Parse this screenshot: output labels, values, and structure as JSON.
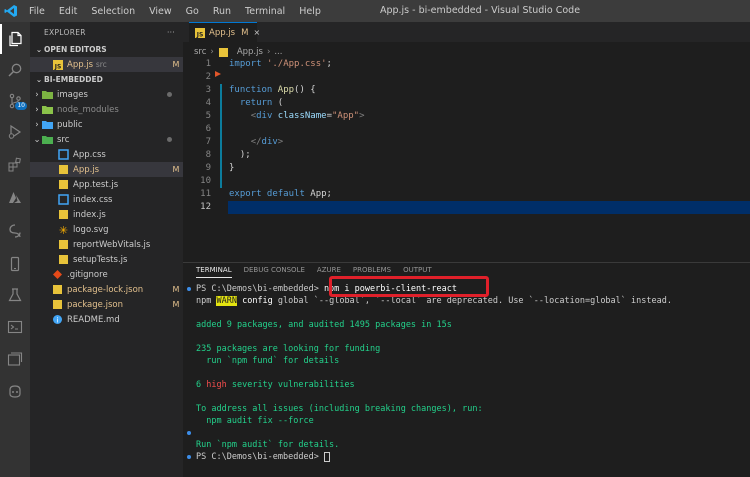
{
  "menu": [
    "File",
    "Edit",
    "Selection",
    "View",
    "Go",
    "Run",
    "Terminal",
    "Help"
  ],
  "window_title": "App.js - bi-embedded - Visual Studio Code",
  "activity_badge": "10",
  "sidebar": {
    "title": "EXPLORER",
    "more": "···",
    "open_editors": {
      "header": "OPEN EDITORS",
      "file": "App.js",
      "folder": "src",
      "status": "M"
    },
    "project": {
      "header": "BI-EMBEDDED",
      "items": [
        {
          "label": "images",
          "type": "folder",
          "status": "dot"
        },
        {
          "label": "node_modules",
          "type": "folder",
          "status": ""
        },
        {
          "label": "public",
          "type": "folder",
          "status": ""
        },
        {
          "label": "src",
          "type": "folder-open",
          "status": "dot"
        },
        {
          "label": "App.css",
          "type": "css",
          "status": ""
        },
        {
          "label": "App.js",
          "type": "js",
          "status": "M"
        },
        {
          "label": "App.test.js",
          "type": "test",
          "status": ""
        },
        {
          "label": "index.css",
          "type": "css",
          "status": ""
        },
        {
          "label": "index.js",
          "type": "js",
          "status": ""
        },
        {
          "label": "logo.svg",
          "type": "svg",
          "status": ""
        },
        {
          "label": "reportWebVitals.js",
          "type": "js",
          "status": ""
        },
        {
          "label": "setupTests.js",
          "type": "js",
          "status": ""
        },
        {
          "label": ".gitignore",
          "type": "git",
          "status": ""
        },
        {
          "label": "package-lock.json",
          "type": "json",
          "status": "M"
        },
        {
          "label": "package.json",
          "type": "json",
          "status": "M"
        },
        {
          "label": "README.md",
          "type": "md",
          "status": ""
        }
      ]
    }
  },
  "editor": {
    "tab_label": "App.js",
    "tab_status": "M",
    "breadcrumb": [
      "src",
      "App.js",
      "..."
    ],
    "lines": [
      {
        "n": "1",
        "tokens": [
          [
            "k",
            "import "
          ],
          [
            "s",
            "'./App.css'"
          ],
          [
            "",
            "; "
          ]
        ]
      },
      {
        "n": "2",
        "tokens": []
      },
      {
        "n": "3",
        "tokens": [
          [
            "k",
            "function "
          ],
          [
            "f",
            "App"
          ],
          [
            "",
            "() {"
          ]
        ]
      },
      {
        "n": "4",
        "tokens": [
          [
            "",
            "  "
          ],
          [
            "k",
            "return "
          ],
          [
            "",
            "("
          ]
        ]
      },
      {
        "n": "5",
        "tokens": [
          [
            "",
            "    "
          ],
          [
            "g",
            "<"
          ],
          [
            "t",
            "div "
          ],
          [
            "a",
            "className"
          ],
          [
            "",
            "="
          ],
          [
            "s",
            "\"App\""
          ],
          [
            "g",
            ">"
          ]
        ]
      },
      {
        "n": "6",
        "tokens": []
      },
      {
        "n": "7",
        "tokens": [
          [
            "",
            "    "
          ],
          [
            "g",
            "</"
          ],
          [
            "t",
            "div"
          ],
          [
            "g",
            ">"
          ]
        ]
      },
      {
        "n": "8",
        "tokens": [
          [
            "",
            "  );"
          ]
        ]
      },
      {
        "n": "9",
        "tokens": [
          [
            "",
            "}"
          ]
        ]
      },
      {
        "n": "10",
        "tokens": []
      },
      {
        "n": "11",
        "tokens": [
          [
            "k",
            "export default "
          ],
          [
            "",
            "App;"
          ]
        ]
      },
      {
        "n": "12",
        "tokens": []
      }
    ]
  },
  "panel": {
    "tabs": [
      "TERMINAL",
      "DEBUG CONSOLE",
      "AZURE",
      "PROBLEMS",
      "OUTPUT"
    ],
    "terminal": {
      "prompt": "PS C:\\Demos\\bi-embedded> ",
      "command": "npm i powerbi-client-react",
      "warn_prefix": "npm ",
      "warn_badge": "WARN",
      "warn_config": " config",
      "warn_rest": " global `--global`, `--local` are deprecated. Use `--location=global` instead.",
      "added": "added 9 packages, and audited 1495 packages in 15s",
      "funding1": "235 packages are looking for funding",
      "funding2": "  run `npm fund` for details",
      "vuln_count": "6 ",
      "vuln_level": "high",
      "vuln_rest": " severity vulnerabilities",
      "address": "To address all issues (including breaking changes), run:",
      "fix": "  npm audit fix --force",
      "audit": "Run `npm audit` for details.",
      "final_prompt": "PS C:\\Demos\\bi-embedded> "
    }
  }
}
